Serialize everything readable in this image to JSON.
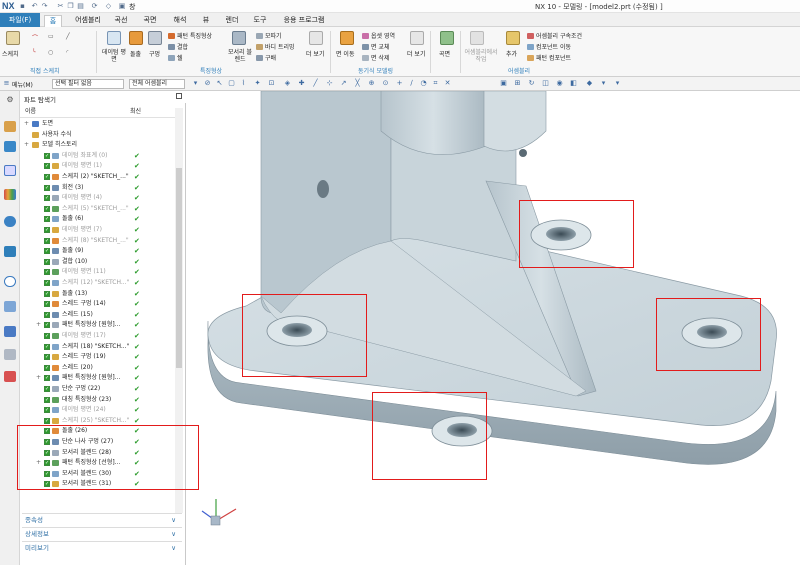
{
  "app": {
    "logo": "NX",
    "window_title": "NX 10 - 모델링 - [model2.prt (수정됨) ]",
    "menu_label": "창"
  },
  "menu": {
    "file": "파일(F)",
    "tabs": [
      "홈",
      "어셈블리",
      "곡선",
      "곡면",
      "해석",
      "뷰",
      "렌더",
      "도구",
      "응용 프로그램"
    ]
  },
  "ribbon": {
    "sketch": "스케치",
    "direct_sketch_group": "직접 스케치",
    "datum": "데이텀 평면",
    "extrude": "돌출",
    "hole": "구멍",
    "pattern_feature": "패턴 특징형상",
    "unite": "결합",
    "shell": "쉘",
    "edge_blend": "모서리 블렌드",
    "chamfer": "모따기",
    "draft": "바디 트리밍",
    "draft2": "구배",
    "more1": "더 보기",
    "feature_group": "특징형상",
    "move_face": "면 이동",
    "offset_region": "옵셋 영역",
    "replace_face": "면 교체",
    "delete_face": "면 삭제",
    "more2": "더 보기",
    "sync_group": "동기식 모델링",
    "surface": "곡면",
    "assembly_feature": "어셈블리에서 작업",
    "add": "추가",
    "constraint": "어셈블리 구속조건",
    "move_component": "컴포넌트 이동",
    "pattern_component": "패턴 컴포넌트",
    "assembly_group": "어셈블리"
  },
  "toolbar": {
    "menu_label": "메뉴(M)",
    "filter": "선택 필터 없음",
    "scope": "전체 어셈블리"
  },
  "nav": {
    "title": "파트 탐색기",
    "col_name": "이름",
    "col_latest": "최신",
    "top_items": [
      {
        "label": "도면"
      },
      {
        "label": "사용자 수식"
      },
      {
        "label": "모델 히스토리"
      }
    ],
    "items": [
      {
        "label": "데이텀 좌표계 (0)",
        "dim": true
      },
      {
        "label": "데이텀 평면 (1)",
        "dim": true
      },
      {
        "label": "스케치 (2) \"SKETCH_...\"",
        "dim": false
      },
      {
        "label": "회전 (3)",
        "dim": false
      },
      {
        "label": "데이텀 평면 (4)",
        "dim": true
      },
      {
        "label": "스케치 (5) \"SKETCH_...\"",
        "dim": true
      },
      {
        "label": "돌출 (6)",
        "dim": false
      },
      {
        "label": "데이텀 평면 (7)",
        "dim": true
      },
      {
        "label": "스케치 (8) \"SKETCH_...\"",
        "dim": true
      },
      {
        "label": "돌출 (9)",
        "dim": false
      },
      {
        "label": "결합 (10)",
        "dim": false
      },
      {
        "label": "데이텀 평면 (11)",
        "dim": true
      },
      {
        "label": "스케치 (12) \"SKETCH...\"",
        "dim": true
      },
      {
        "label": "돌출 (13)",
        "dim": false
      },
      {
        "label": "스레드 구멍 (14)",
        "dim": false
      },
      {
        "label": "스레드 (15)",
        "dim": false
      },
      {
        "label": "패턴 특징형상 [원형]...",
        "dim": false,
        "expand": true
      },
      {
        "label": "데이텀 평면 (17)",
        "dim": true
      },
      {
        "label": "스케치 (18) \"SKETCH...\"",
        "dim": false
      },
      {
        "label": "스레드 구멍 (19)",
        "dim": false
      },
      {
        "label": "스레드 (20)",
        "dim": false
      },
      {
        "label": "패턴 특징형상 [원형]...",
        "dim": false,
        "expand": true
      },
      {
        "label": "단순 구멍 (22)",
        "dim": false
      },
      {
        "label": "대칭 특징형상 (23)",
        "dim": false
      },
      {
        "label": "데이텀 평면 (24)",
        "dim": true
      },
      {
        "label": "스케치 (25) \"SKETCH...\"",
        "dim": true
      },
      {
        "label": "돌출 (26)",
        "dim": false
      },
      {
        "label": "단순 나사 구멍 (27)",
        "dim": false
      },
      {
        "label": "모서리 블렌드 (28)",
        "dim": false
      },
      {
        "label": "패턴 특징형상 [선형]...",
        "dim": false,
        "expand": true
      },
      {
        "label": "모서리 블렌드 (30)",
        "dim": false
      },
      {
        "label": "모서리 블렌드 (31)",
        "dim": false
      }
    ],
    "sections": [
      "종속성",
      "상세정보",
      "미리보기"
    ]
  },
  "colors": {
    "accent": "#2f7fba",
    "highlight": "#e21b1b",
    "model": "#c9d6dc"
  }
}
